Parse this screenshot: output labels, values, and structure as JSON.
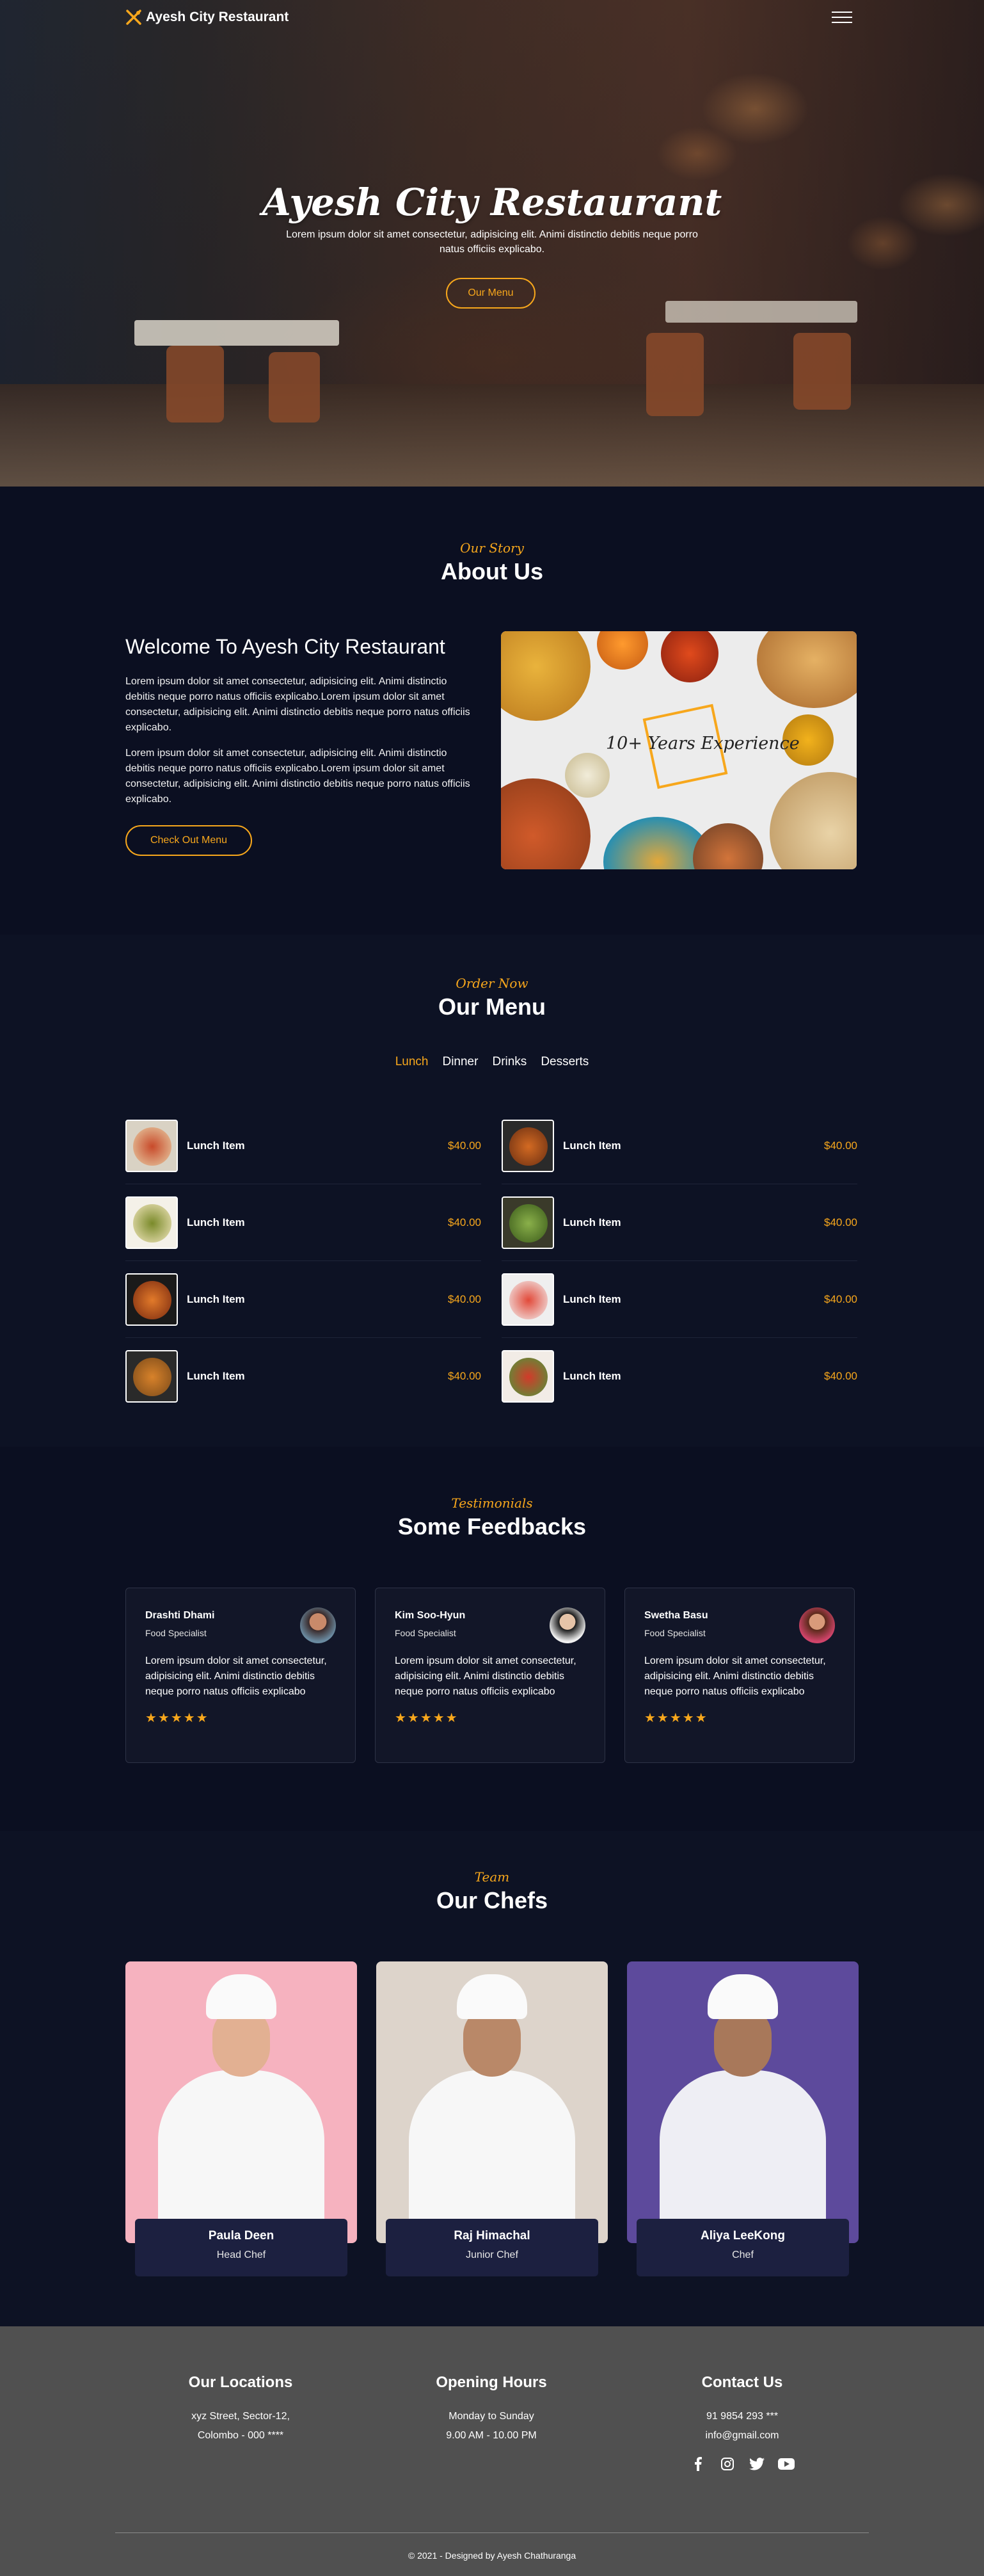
{
  "nav": {
    "brand": "Ayesh City Restaurant",
    "logo_icon": "utensils-icon",
    "menu_icon": "hamburger-menu-icon"
  },
  "hero": {
    "title": "Ayesh City Restaurant",
    "text": "Lorem ipsum dolor sit amet consectetur, adipisicing elit. Animi distinctio debitis neque porro natus officiis explicabo.",
    "button": "Our Menu"
  },
  "about": {
    "subtitle": "Our Story",
    "title": "About Us",
    "heading": "Welcome To Ayesh City Restaurant",
    "para1": "Lorem ipsum dolor sit amet consectetur, adipisicing elit. Animi distinctio debitis neque porro natus officiis explicabo.Lorem ipsum dolor sit amet consectetur, adipisicing elit. Animi distinctio debitis neque porro natus officiis explicabo.",
    "para2": "Lorem ipsum dolor sit amet consectetur, adipisicing elit. Animi distinctio debitis neque porro natus officiis explicabo.Lorem ipsum dolor sit amet consectetur, adipisicing elit. Animi distinctio debitis neque porro natus officiis explicabo.",
    "button": "Check Out Menu",
    "image_caption": "10+ Years Experience"
  },
  "menu": {
    "subtitle": "Order Now",
    "title": "Our Menu",
    "tabs": [
      "Lunch",
      "Dinner",
      "Drinks",
      "Desserts"
    ],
    "active_tab": "Lunch",
    "items": [
      {
        "name": "Lunch Item",
        "price": "$40.00"
      },
      {
        "name": "Lunch Item",
        "price": "$40.00"
      },
      {
        "name": "Lunch Item",
        "price": "$40.00"
      },
      {
        "name": "Lunch Item",
        "price": "$40.00"
      },
      {
        "name": "Lunch Item",
        "price": "$40.00"
      },
      {
        "name": "Lunch Item",
        "price": "$40.00"
      },
      {
        "name": "Lunch Item",
        "price": "$40.00"
      },
      {
        "name": "Lunch Item",
        "price": "$40.00"
      }
    ]
  },
  "feedback": {
    "subtitle": "Testimonials",
    "title": "Some Feedbacks",
    "cards": [
      {
        "name": "Drashti Dhami",
        "role": "Food Specialist",
        "text": "Lorem ipsum dolor sit amet consectetur, adipisicing elit. Animi distinctio debitis neque porro natus officiis explicabo",
        "rating": 5
      },
      {
        "name": "Kim Soo-Hyun",
        "role": "Food Specialist",
        "text": "Lorem ipsum dolor sit amet consectetur, adipisicing elit. Animi distinctio debitis neque porro natus officiis explicabo",
        "rating": 5
      },
      {
        "name": "Swetha Basu",
        "role": "Food Specialist",
        "text": "Lorem ipsum dolor sit amet consectetur, adipisicing elit. Animi distinctio debitis neque porro natus officiis explicabo",
        "rating": 5
      }
    ]
  },
  "chefs": {
    "subtitle": "Team",
    "title": "Our Chefs",
    "list": [
      {
        "name": "Paula Deen",
        "role": "Head Chef",
        "bg": "#f6b2bf"
      },
      {
        "name": "Raj Himachal",
        "role": "Junior Chef",
        "bg": "#ddd4cb"
      },
      {
        "name": "Aliya LeeKong",
        "role": "Chef",
        "bg": "#5d4a9c"
      }
    ]
  },
  "footer": {
    "locations_title": "Our Locations",
    "locations_line1": "xyz Street, Sector-12,",
    "locations_line2": "Colombo - 000 ****",
    "hours_title": "Opening Hours",
    "hours_line1": "Monday to Sunday",
    "hours_line2": "9.00 AM - 10.00 PM",
    "contact_title": "Contact Us",
    "phone": "91 9854 293 ***",
    "email": "info@gmail.com",
    "social_icons": [
      "facebook-icon",
      "instagram-icon",
      "twitter-icon",
      "youtube-icon"
    ],
    "copyright": "© 2021 - Designed by Ayesh Chathuranga"
  },
  "colors": {
    "accent": "#f7a71c",
    "background": "#0c1022",
    "footer": "#505050"
  }
}
